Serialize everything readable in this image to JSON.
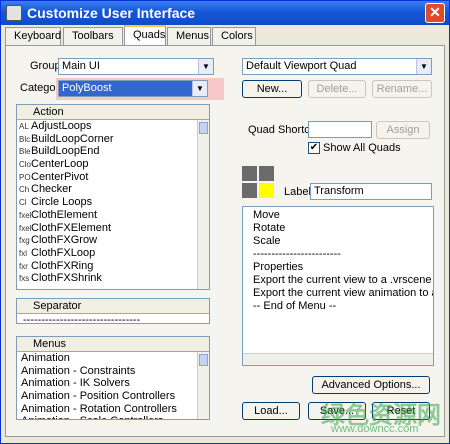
{
  "window": {
    "title": "Customize User Interface",
    "close_glyph": "✕"
  },
  "tabs": [
    "Keyboard",
    "Toolbars",
    "Quads",
    "Menus",
    "Colors"
  ],
  "group": {
    "label": "Group:",
    "value": "Main UI"
  },
  "category": {
    "label": "Category:",
    "value": "PolyBoost"
  },
  "actions": {
    "header": "Action",
    "items": [
      {
        "icon": "AL",
        "label": "AdjustLoops"
      },
      {
        "icon": "Blc",
        "label": "BuildLoopCorner"
      },
      {
        "icon": "Ble",
        "label": "BuildLoopEnd"
      },
      {
        "icon": "Clo",
        "label": "CenterLoop"
      },
      {
        "icon": "PO",
        "label": "CenterPivot"
      },
      {
        "icon": "Ch",
        "label": "Checker"
      },
      {
        "icon": "Cl",
        "label": "Circle Loops"
      },
      {
        "icon": "fxel",
        "label": "ClothElement"
      },
      {
        "icon": "fxel",
        "label": "ClothFXElement"
      },
      {
        "icon": "fxg",
        "label": "ClothFXGrow"
      },
      {
        "icon": "fxl",
        "label": "ClothFXLoop"
      },
      {
        "icon": "fxr",
        "label": "ClothFXRing"
      },
      {
        "icon": "fxs",
        "label": "ClothFXShrink"
      }
    ]
  },
  "separator": {
    "header": "Separator",
    "item": "--------------------------------"
  },
  "menus": {
    "header": "Menus",
    "items": [
      "Animation",
      "Animation - Constraints",
      "Animation - IK Solvers",
      "Animation - Position Controllers",
      "Animation - Rotation Controllers",
      "Animation - Scale Controllers"
    ]
  },
  "quad_set": {
    "value": "Default Viewport Quad"
  },
  "quad_buttons": {
    "new": "New...",
    "delete": "Delete...",
    "rename": "Rename..."
  },
  "quad_shortcut": {
    "label": "Quad Shortcut:",
    "value": "",
    "assign": "Assign"
  },
  "show_all_quads": {
    "label": "Show All Quads",
    "checked": "✔"
  },
  "quad_label": {
    "label": "Label:",
    "value": "Transform"
  },
  "quad_colors": {
    "active": "#ffff00",
    "inactive": "#6b6b6b"
  },
  "quad_menu_items": [
    "Move",
    "Rotate",
    "Scale",
    "------------------------",
    "Properties",
    "Export the current view to a .vrscene file",
    "Export the current view animation to a .vrscene",
    "-- End of Menu --"
  ],
  "bottom_buttons": {
    "advanced": "Advanced Options...",
    "load": "Load...",
    "save": "Save...",
    "reset": "Reset"
  },
  "watermark": {
    "text": "绿色资源网",
    "url": "www.downcc.com"
  }
}
